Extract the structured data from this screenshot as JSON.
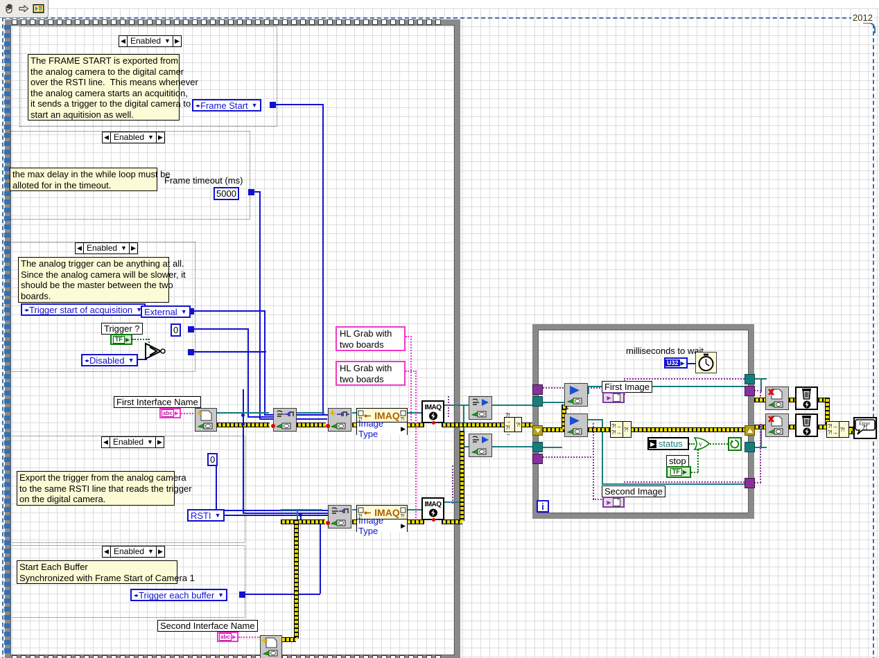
{
  "window": {
    "version_label": "2012"
  },
  "toolbar": {
    "items": [
      {
        "name": "pan-tool",
        "label": "Pan / scroll tool"
      },
      {
        "name": "run-arrow",
        "label": "Run"
      },
      {
        "name": "vi-icon",
        "label": "VI icon"
      }
    ]
  },
  "structures": {
    "disable_1": {
      "state": "Enabled"
    },
    "disable_2": {
      "state": "Enabled"
    },
    "disable_3": {
      "state": "Enabled"
    },
    "disable_4": {
      "state": "Enabled"
    },
    "disable_5": {
      "state": "Enabled"
    }
  },
  "notes": {
    "frame_start": "The FRAME START is exported from\nthe analog camera to the digital camer\nover the RSTI line.  This means whenever\nthe analog camera starts an acquitition,\nit sends a trigger to the digital camera to\nstart an aquitision as well.",
    "timeout": "the max delay in the while loop must be\nalloted for in the timeout.",
    "analog_trigger": "The analog trigger can be anything at all.\nSince the analog camera will be slower, it\nshould be the master between the two\nboards.",
    "export_trigger": "Export the trigger from the analog camera\nto the same RSTI line that reads the trigger\non the digital camera.",
    "start_each_buffer": "Start Each Buffer\nSynchronized with Frame Start of Camera 1"
  },
  "controls": {
    "frame_start_ring": "Frame Start",
    "frame_timeout_label": "Frame timeout (ms)",
    "frame_timeout_value": "5000",
    "trigger_start_ring": "Trigger start of acquisition",
    "external_ring": "External",
    "zero_const_a": "0",
    "disabled_ring": "Disabled",
    "trigger_label": "Trigger ?",
    "trigger_bool": "TF",
    "first_interface_label": "First Interface Name",
    "first_interface_type": "abc",
    "zero_const_b": "0",
    "rsti_ring": "RSTI",
    "trigger_each_buffer_ring": "Trigger each buffer",
    "second_interface_label": "Second Interface Name",
    "second_interface_type": "abc"
  },
  "subvi_labels": {
    "hl_grab_1": "HL Grab with\ntwo boards",
    "hl_grab_2": "HL Grab with\ntwo boards"
  },
  "property_nodes": {
    "image_type_1": {
      "title": "IMAQ",
      "property": "Image Type"
    },
    "image_type_2": {
      "title": "IMAQ",
      "property": "Image Type"
    }
  },
  "imaq_nodes": {
    "create_1": "IMAQ",
    "create_2": "IMAQ"
  },
  "while_loop": {
    "wait_label": "milliseconds to wait",
    "wait_type": "U32",
    "first_image_label": "First Image",
    "second_image_label": "Second Image",
    "status_name": "status",
    "stop_label": "stop",
    "stop_bool": "TF",
    "iteration_terminal": "i"
  },
  "error_chain": {
    "error_handler_line1": "Error",
    "error_handler_line2": "?!"
  },
  "colors": {
    "error_wire": "#e8dc00",
    "image_wire": "#8a2f9e",
    "session_wire": "#167d7d",
    "numeric_wire": "#1111d0",
    "string_wire": "#ef37c8",
    "structure_gray": "#8a8a8a",
    "note_yellow": "#fcfbd6"
  }
}
